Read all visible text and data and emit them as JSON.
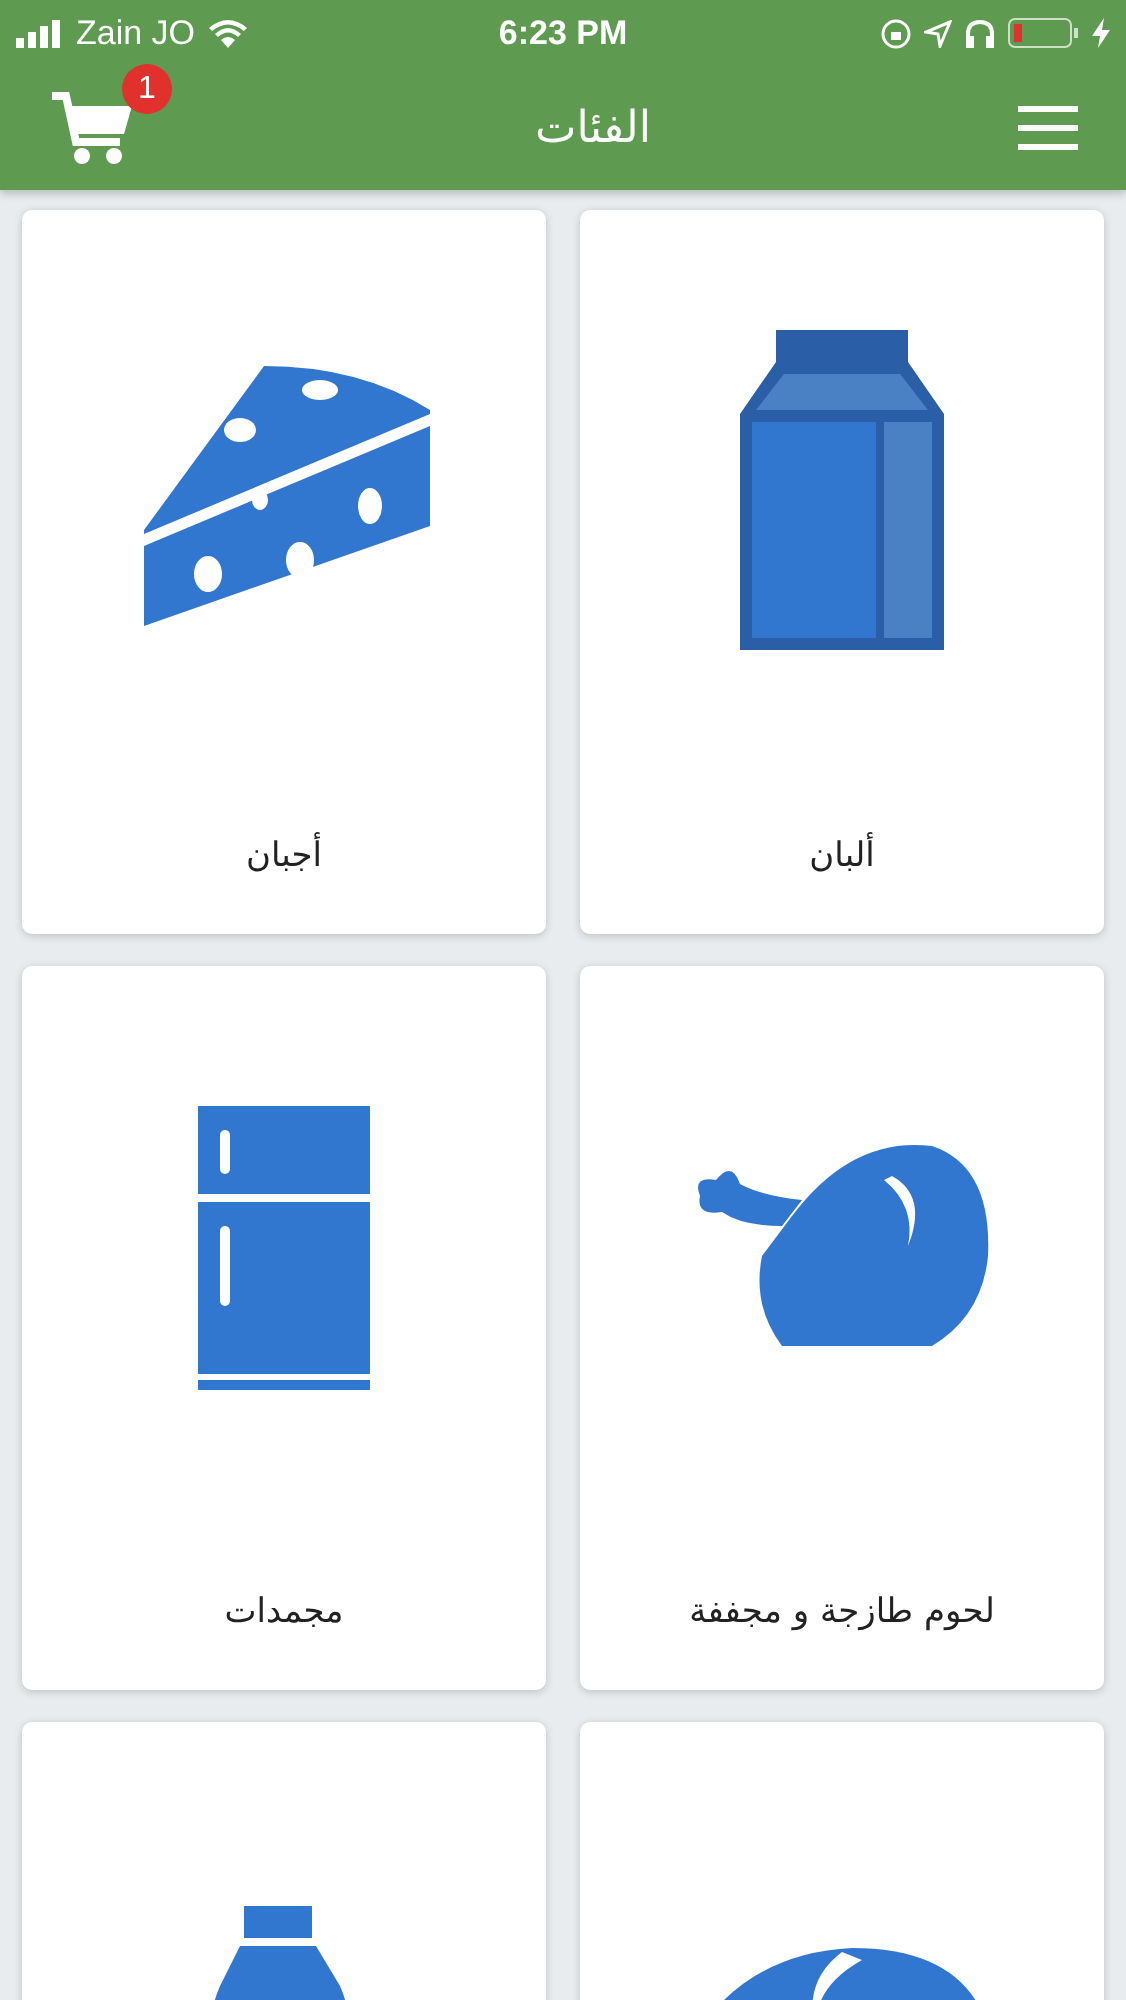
{
  "status_bar": {
    "carrier": "Zain JO",
    "time": "6:23 PM"
  },
  "header": {
    "title": "الفئات",
    "cart_count": "1"
  },
  "categories": [
    {
      "kind": "milk",
      "label": "ألبان"
    },
    {
      "kind": "cheese",
      "label": "أجبان"
    },
    {
      "kind": "chicken",
      "label": "لحوم طازجة و مجففة"
    },
    {
      "kind": "fridge",
      "label": "مجمدات"
    },
    {
      "kind": "bread"
    },
    {
      "kind": "bottle"
    }
  ]
}
